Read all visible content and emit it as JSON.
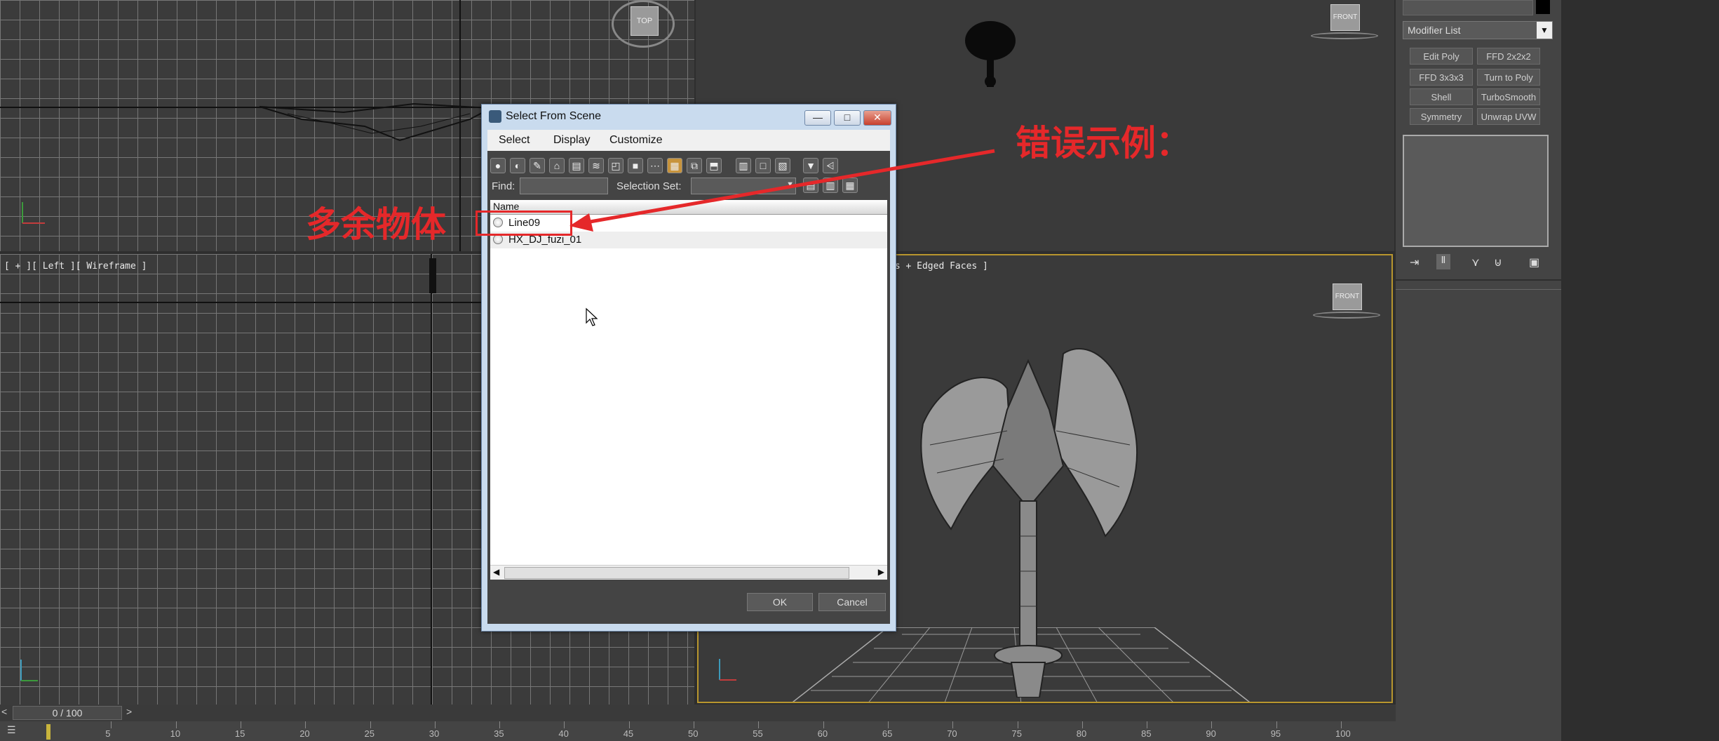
{
  "viewports": {
    "top_left_label": "",
    "left": {
      "label": "[ + ][ Left ][ Wireframe ]"
    },
    "perspective": {
      "label": "ts + Edged Faces ]"
    },
    "viewcube_top": "TOP",
    "viewcube_front": "FRONT"
  },
  "command_panel": {
    "modifier_list": "Modifier List",
    "buttons": [
      "Edit Poly",
      "FFD 2x2x2",
      "FFD 3x3x3",
      "Turn to Poly",
      "Shell",
      "TurboSmooth",
      "Symmetry",
      "Unwrap UVW"
    ]
  },
  "dialog": {
    "title": "Select From Scene",
    "menus": [
      "Select",
      "Display",
      "Customize"
    ],
    "find_label": "Find:",
    "find_value": "",
    "selection_set_label": "Selection Set:",
    "column_name": "Name",
    "rows": [
      "Line09",
      "HX_DJ_fuzi_01"
    ],
    "ok": "OK",
    "cancel": "Cancel",
    "min_glyph": "—",
    "max_glyph": "□",
    "close_glyph": "✕"
  },
  "timeline": {
    "frame_counter": "0 / 100",
    "prev": "<",
    "next": ">",
    "ticks": [
      "5",
      "10",
      "15",
      "20",
      "25",
      "30",
      "35",
      "40",
      "45",
      "50",
      "55",
      "60",
      "65",
      "70",
      "75",
      "80",
      "85",
      "90",
      "95",
      "100"
    ]
  },
  "annotations": {
    "error_example": "错误示例：",
    "extra_object": "多余物体"
  },
  "colors": {
    "annotation_red": "#e5282a",
    "active_viewport_border": "#b8962e"
  }
}
